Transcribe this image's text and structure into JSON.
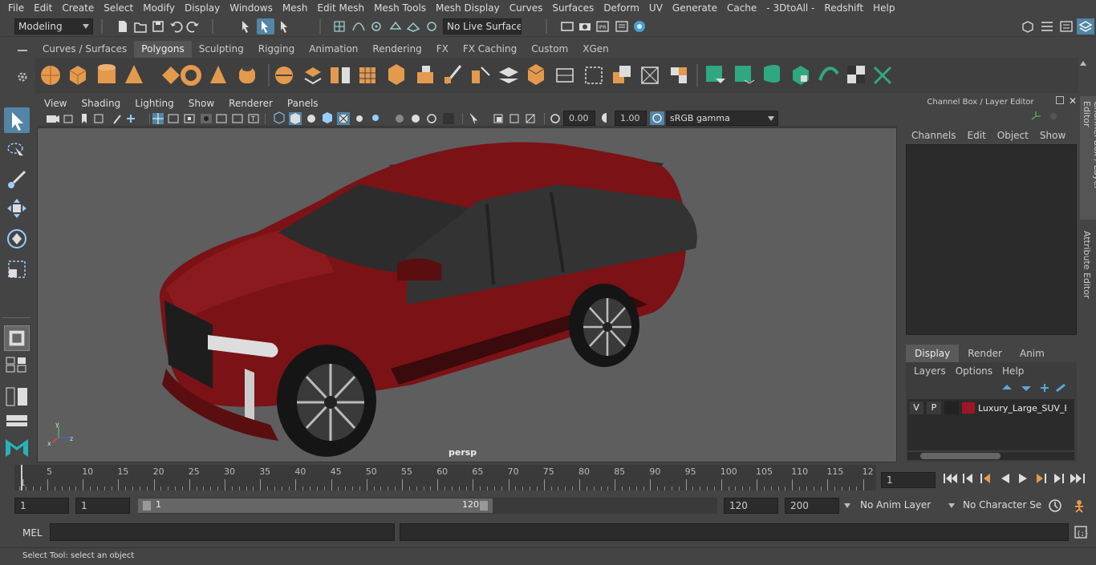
{
  "menu": [
    "File",
    "Edit",
    "Create",
    "Select",
    "Modify",
    "Display",
    "Windows",
    "Mesh",
    "Edit Mesh",
    "Mesh Tools",
    "Mesh Display",
    "Curves",
    "Surfaces",
    "Deform",
    "UV",
    "Generate",
    "Cache",
    "- 3DtoAll -",
    "Redshift",
    "Help"
  ],
  "status": {
    "workspace": "Modeling",
    "live_surface": "No Live Surface"
  },
  "shelf_tabs": [
    "Curves / Surfaces",
    "Polygons",
    "Sculpting",
    "Rigging",
    "Animation",
    "Rendering",
    "FX",
    "FX Caching",
    "Custom",
    "XGen"
  ],
  "active_shelf": "Polygons",
  "viewport": {
    "menu": [
      "View",
      "Shading",
      "Lighting",
      "Show",
      "Renderer",
      "Panels"
    ],
    "exposure": "0.00",
    "gamma": "1.00",
    "colorspace": "sRGB gamma",
    "camera_label": "persp"
  },
  "channel_box": {
    "title": "Channel Box / Layer Editor",
    "menu": [
      "Channels",
      "Edit",
      "Object",
      "Show"
    ],
    "tabs": [
      "Display",
      "Render",
      "Anim"
    ],
    "layer_menu": [
      "Layers",
      "Options",
      "Help"
    ],
    "layer": {
      "v": "V",
      "p": "P",
      "name": "Luxury_Large_SUV_Exte",
      "color": "#a01428"
    }
  },
  "side_tabs": [
    "Channel Box / Layer Editor",
    "Attribute Editor"
  ],
  "timeline": {
    "ticks": [
      "5",
      "10",
      "15",
      "20",
      "25",
      "30",
      "35",
      "40",
      "45",
      "50",
      "55",
      "60",
      "65",
      "70",
      "75",
      "80",
      "85",
      "90",
      "95",
      "100",
      "105",
      "110",
      "115",
      "12"
    ],
    "start_marker": "1",
    "current_frame": "1"
  },
  "range": {
    "start": "1",
    "playback_start": "1",
    "slider_start": "1",
    "slider_end": "120",
    "playback_end": "120",
    "end": "200",
    "anim_layer": "No Anim Layer",
    "character_set": "No Character Set"
  },
  "command": {
    "label": "MEL"
  },
  "help_line": "Select Tool: select an object",
  "colors": {
    "accent": "#5285a6",
    "car": "#7a1216",
    "bg": "#444444"
  }
}
